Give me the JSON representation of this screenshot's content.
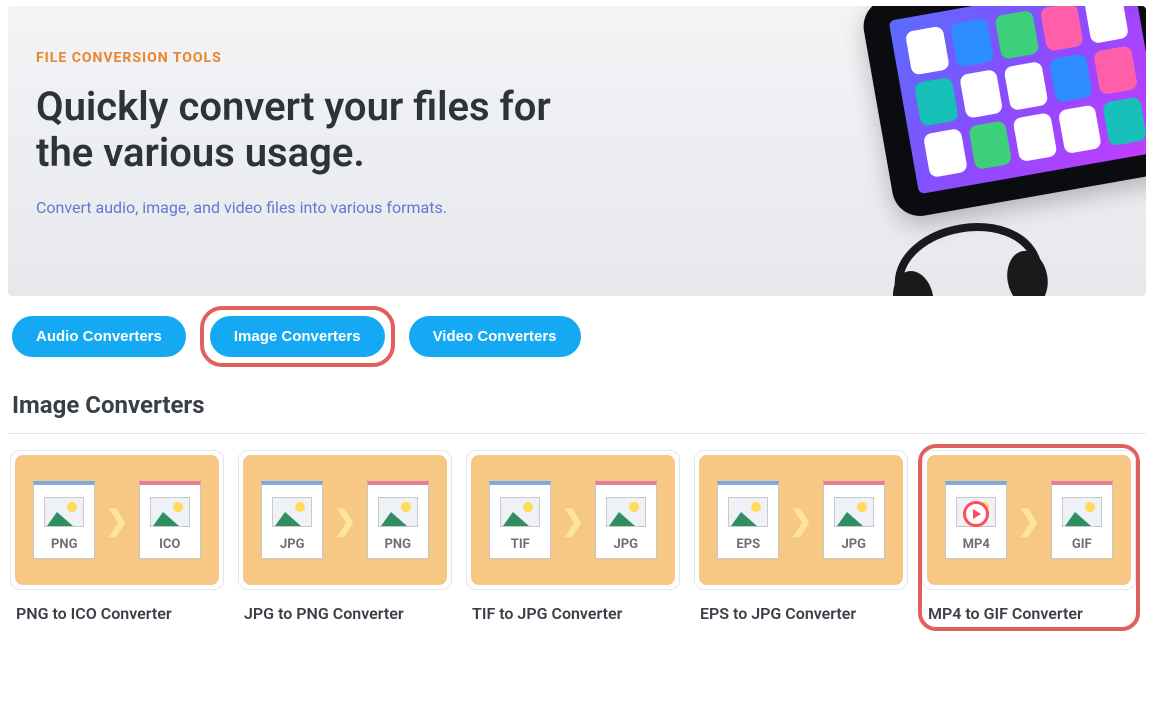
{
  "hero": {
    "eyebrow": "FILE CONVERSION TOOLS",
    "headline": "Quickly convert your files for the various usage.",
    "subhead": "Convert audio, image, and video files into various formats."
  },
  "tabs": [
    {
      "label": "Audio Converters",
      "active": false,
      "highlighted": false
    },
    {
      "label": "Image Converters",
      "active": true,
      "highlighted": true
    },
    {
      "label": "Video Converters",
      "active": false,
      "highlighted": false
    }
  ],
  "section": {
    "title": "Image Converters"
  },
  "cards": [
    {
      "from": "PNG",
      "to": "ICO",
      "label": "PNG to ICO Converter",
      "fromKind": "image",
      "toKind": "image",
      "highlighted": false
    },
    {
      "from": "JPG",
      "to": "PNG",
      "label": "JPG to PNG Converter",
      "fromKind": "image",
      "toKind": "image",
      "highlighted": false
    },
    {
      "from": "TIF",
      "to": "JPG",
      "label": "TIF to JPG Converter",
      "fromKind": "image",
      "toKind": "image",
      "highlighted": false
    },
    {
      "from": "EPS",
      "to": "JPG",
      "label": "EPS to JPG Converter",
      "fromKind": "image",
      "toKind": "image",
      "highlighted": false
    },
    {
      "from": "MP4",
      "to": "GIF",
      "label": "MP4 to GIF Converter",
      "fromKind": "video",
      "toKind": "image",
      "highlighted": true
    }
  ]
}
